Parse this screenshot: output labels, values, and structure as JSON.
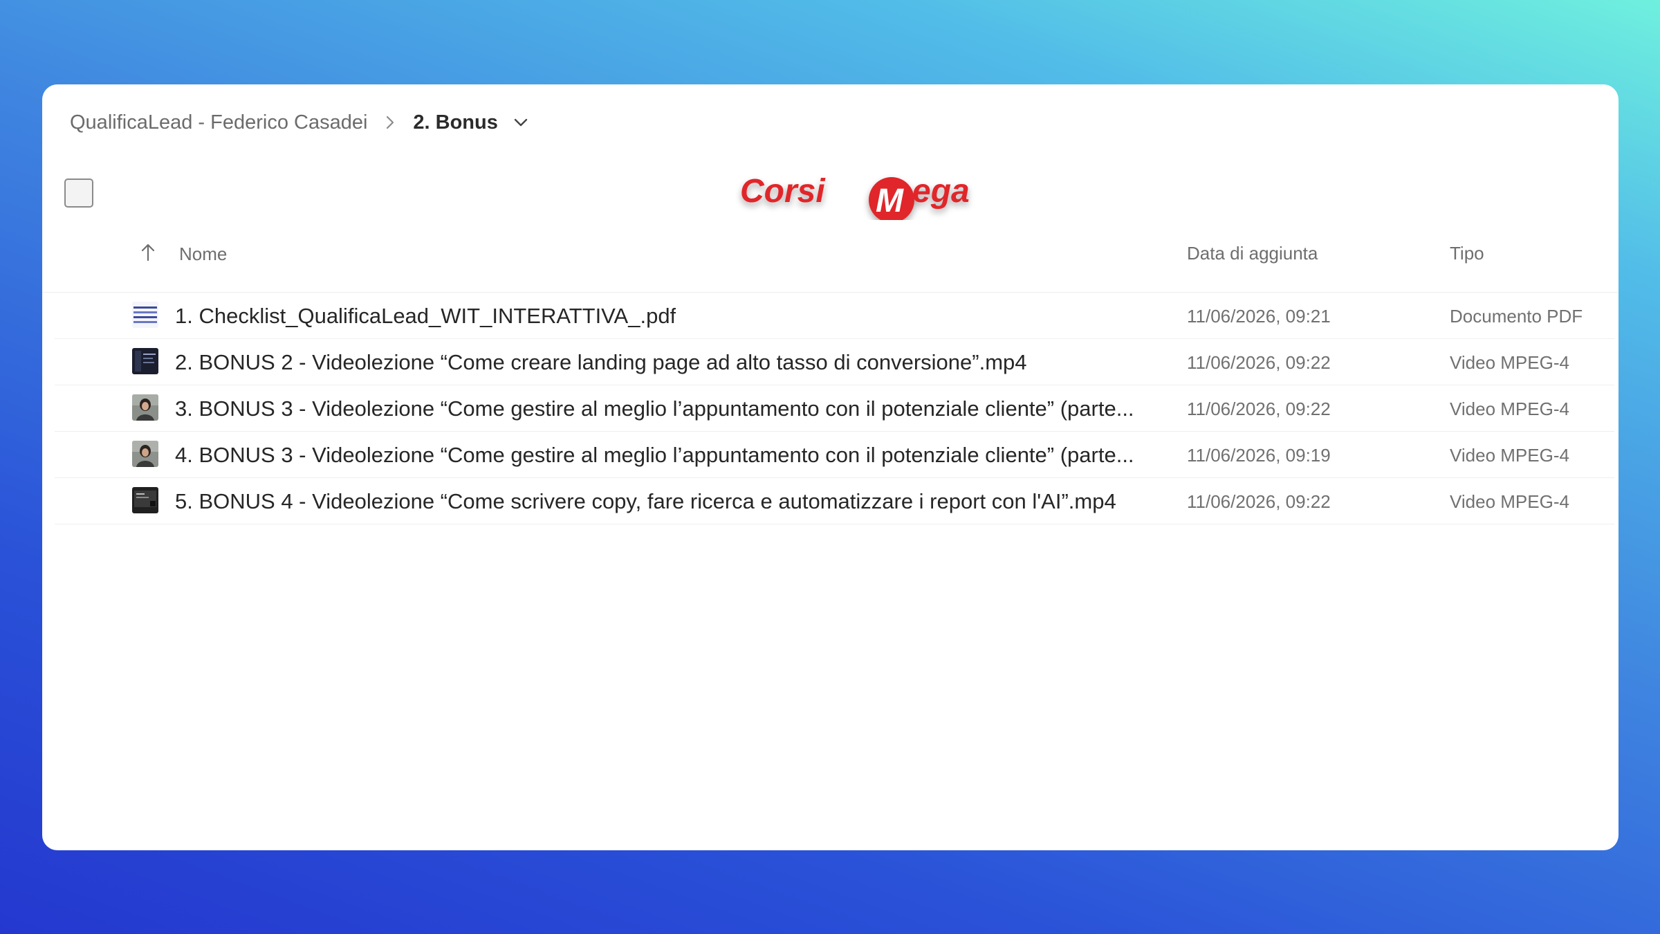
{
  "breadcrumb": {
    "parent": "QualificaLead - Federico Casadei",
    "current": "2. Bonus"
  },
  "logo": {
    "text_left": "Corsi",
    "text_right": "ega",
    "badge_letter": "M",
    "color": "#e0262b"
  },
  "table": {
    "columns": {
      "name": "Nome",
      "date": "Data di aggiunta",
      "type": "Tipo"
    },
    "rows": [
      {
        "name": "1. Checklist_QualificaLead_WIT_INTERATTIVA_.pdf",
        "date": "11/06/2026, 09:21",
        "type": "Documento PDF",
        "icon": "pdf-doc-icon"
      },
      {
        "name": "2. BONUS 2 - Videolezione “Come creare landing page ad alto tasso di conversione”.mp4",
        "date": "11/06/2026, 09:22",
        "type": "Video MPEG-4",
        "icon": "video-thumbnail-dark-icon"
      },
      {
        "name": "3. BONUS 3 - Videolezione “Come gestire al meglio l’appuntamento con il potenziale cliente” (parte...",
        "date": "11/06/2026, 09:22",
        "type": "Video MPEG-4",
        "icon": "video-thumbnail-person-icon"
      },
      {
        "name": "4. BONUS 3 - Videolezione “Come gestire al meglio l’appuntamento con il potenziale cliente” (parte...",
        "date": "11/06/2026, 09:19",
        "type": "Video MPEG-4",
        "icon": "video-thumbnail-person-icon"
      },
      {
        "name": "5. BONUS 4 - Videolezione “Come scrivere copy, fare ricerca e automatizzare i report con l'AI”.mp4",
        "date": "11/06/2026, 09:22",
        "type": "Video MPEG-4",
        "icon": "video-thumbnail-dark-icon"
      }
    ]
  }
}
